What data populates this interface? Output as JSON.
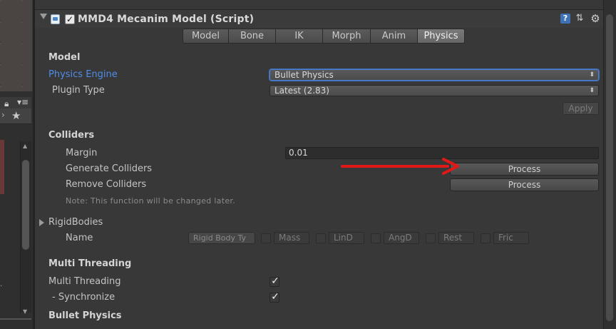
{
  "component": {
    "title": "MMD4 Mecanim Model (Script)",
    "enabled": true
  },
  "tabs": [
    {
      "label": "Model",
      "active": false
    },
    {
      "label": "Bone",
      "active": false
    },
    {
      "label": "IK",
      "active": false
    },
    {
      "label": "Morph",
      "active": false
    },
    {
      "label": "Anim",
      "active": false
    },
    {
      "label": "Physics",
      "active": true
    }
  ],
  "model_section": {
    "heading": "Model",
    "physics_engine_label": "Physics Engine",
    "physics_engine_value": "Bullet Physics",
    "plugin_type_label": "Plugin Type",
    "plugin_type_value": "Latest (2.83)",
    "apply_label": "Apply"
  },
  "colliders_section": {
    "heading": "Colliders",
    "margin_label": "Margin",
    "margin_value": "0.01",
    "generate_label": "Generate Colliders",
    "generate_button": "Process",
    "remove_label": "Remove Colliders",
    "remove_button": "Process",
    "note": "Note: This function will be changed later."
  },
  "rigidbodies_section": {
    "heading": "RigidBodies",
    "name_label": "Name",
    "dropdown_value": "Rigid Body Ty",
    "fields": [
      "Mass",
      "LinD",
      "AngD",
      "Rest",
      "Fric"
    ]
  },
  "multithreading_section": {
    "heading": "Multi Threading",
    "multi_threading_label": "Multi Threading",
    "multi_threading_checked": true,
    "synchronize_label": "- Synchronize",
    "synchronize_checked": true
  },
  "bullet_section": {
    "heading": "Bullet Physics"
  },
  "annotation": {
    "color": "#e01818"
  }
}
